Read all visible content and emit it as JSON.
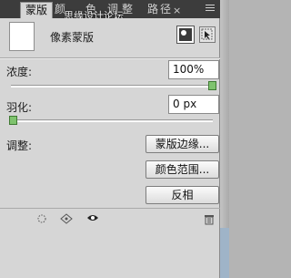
{
  "window": {
    "tabs": [
      {
        "label": "蒙版",
        "active": true
      },
      {
        "label": "颜",
        "active": false
      },
      {
        "label": "色",
        "active": false
      },
      {
        "label": "调",
        "active": false
      },
      {
        "label": "整",
        "active": false
      },
      {
        "label": "路",
        "active": false
      },
      {
        "label": "径",
        "active": false
      }
    ],
    "close_glyph": "×",
    "watermark": "思缘设计论坛"
  },
  "header": {
    "title": "像素蒙版",
    "icons": [
      "pixel-mask-icon",
      "vector-mask-icon"
    ]
  },
  "density": {
    "label": "浓度:",
    "value": "100%",
    "slider_level": 1.0
  },
  "feather": {
    "label": "羽化:",
    "value": "0 px",
    "slider_level": 0.0
  },
  "refine": {
    "label": "调整:",
    "buttons": [
      "蒙版边缘...",
      "颜色范围...",
      "反相"
    ]
  },
  "footer": {
    "icons": [
      "load-selection-icon",
      "apply-mask-icon",
      "visibility-eye-icon",
      "delete-trash-icon"
    ]
  },
  "colors": {
    "accent_slider": "#7fc36e",
    "panel_bg": "#d6d6d6",
    "tabbar_bg": "#3c3c3c"
  }
}
